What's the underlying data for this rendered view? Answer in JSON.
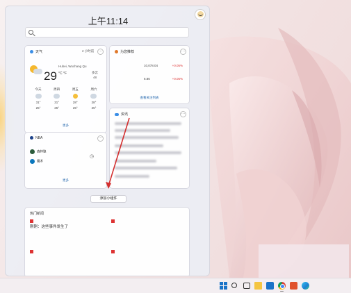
{
  "panel": {
    "time": "上午11:14",
    "search_placeholder": ""
  },
  "weather": {
    "header": "天气",
    "updated": "2 小时前",
    "location": "Hubei, Wuchang Qu",
    "temperature": "29",
    "unit": "°C °F",
    "condition": "多云",
    "humidity": "48",
    "forecast": [
      {
        "day": "今天",
        "high": "31°",
        "low": "25°",
        "icon": "cloudy-icon"
      },
      {
        "day": "周四",
        "high": "31°",
        "low": "25°",
        "icon": "cloudy-icon"
      },
      {
        "day": "周五",
        "high": "28°",
        "low": "25°",
        "icon": "sunny-icon"
      },
      {
        "day": "周六",
        "high": "28°",
        "low": "25°",
        "icon": "cloudy-icon"
      }
    ],
    "link": "更多"
  },
  "stocks": {
    "header": "为您推荐",
    "rows": [
      {
        "name": "",
        "value": "10,078.04",
        "change": "+0.05%"
      },
      {
        "name": "",
        "value": "6.86",
        "change": "+0.05%"
      }
    ],
    "link": "查看关注列表"
  },
  "nba": {
    "header": "NBA",
    "teams": [
      "森林狼",
      "魔术"
    ],
    "link": "更多"
  },
  "news": {
    "header": "资讯"
  },
  "add_widget_label": "添加小组件",
  "stories": {
    "header": "热门新闻",
    "items": [
      {
        "source": "",
        "title": "刚刚：这些事件发生了"
      },
      {
        "source": "",
        "title": ""
      },
      {
        "source": "",
        "title": ""
      },
      {
        "source": "",
        "title": ""
      }
    ]
  },
  "taskbar": {
    "icons": [
      "windows-start-icon",
      "search-icon",
      "task-view-icon",
      "folder-icon",
      "store-icon",
      "chrome-icon",
      "edge-icon",
      "office-icon"
    ]
  },
  "colors": {
    "accent": "#1a73c8",
    "arrow": "#d32f2f",
    "stock_change": "#dd3333"
  }
}
